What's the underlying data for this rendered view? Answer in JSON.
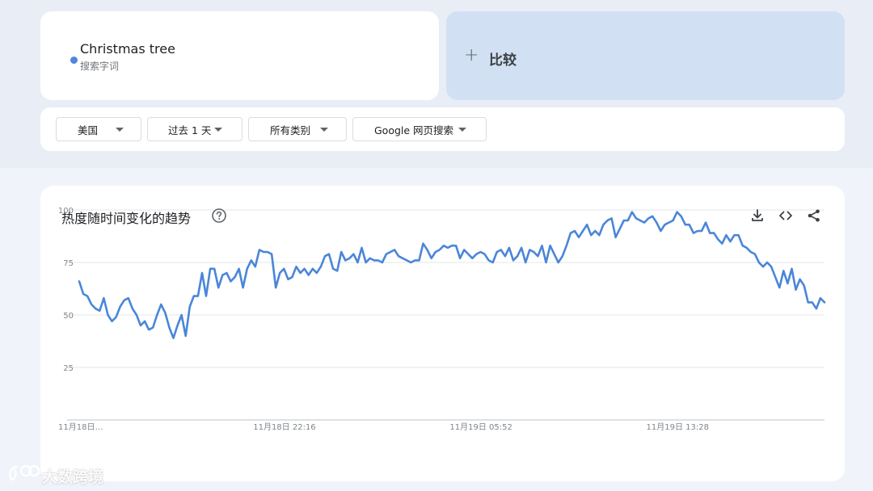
{
  "search_term": {
    "name": "Christmas tree",
    "type": "搜索字词",
    "color": "#4f86e0"
  },
  "compare": {
    "icon": "plus-icon",
    "label": "比较"
  },
  "filters": [
    {
      "label": "美国"
    },
    {
      "label": "过去 1 天"
    },
    {
      "label": "所有类别"
    },
    {
      "label": "Google 网页搜索"
    }
  ],
  "chart_section": {
    "title": "热度随时间变化的趋势",
    "help_icon": "help-circle-icon",
    "actions": [
      "download-icon",
      "embed-code-icon",
      "share-icon"
    ]
  },
  "chart_data": {
    "type": "line",
    "title": "",
    "xlabel": "",
    "ylabel": "",
    "ylim": [
      0,
      100
    ],
    "yticks": [
      25,
      50,
      75,
      100
    ],
    "xtick_labels": [
      "11月18日…",
      "11月18日 22:16",
      "11月19日 05:52",
      "11月19日 13:28"
    ],
    "grid": true,
    "series": [
      {
        "color": "#4a86d8",
        "values": [
          66,
          60,
          59,
          55,
          53,
          52,
          58,
          50,
          47,
          49,
          54,
          57,
          58,
          53,
          50,
          45,
          47,
          43,
          44,
          50,
          55,
          51,
          44,
          39,
          45,
          50,
          40,
          54,
          59,
          59,
          70,
          59,
          72,
          72,
          63,
          69,
          70,
          66,
          68,
          72,
          63,
          72,
          76,
          73,
          81,
          80,
          80,
          79,
          63,
          70,
          72,
          67,
          68,
          73,
          70,
          72,
          69,
          72,
          70,
          73,
          78,
          79,
          72,
          71,
          80,
          76,
          77,
          79,
          75,
          82,
          75,
          77,
          76,
          76,
          75,
          79,
          80,
          81,
          78,
          77,
          76,
          75,
          76,
          76,
          84,
          81,
          77,
          80,
          81,
          83,
          82,
          83,
          83,
          77,
          81,
          79,
          77,
          79,
          80,
          79,
          76,
          75,
          80,
          81,
          78,
          82,
          76,
          78,
          82,
          75,
          81,
          80,
          78,
          83,
          75,
          83,
          79,
          75,
          78,
          83,
          89,
          90,
          87,
          90,
          93,
          88,
          90,
          88,
          93,
          95,
          96,
          87,
          91,
          95,
          95,
          99,
          96,
          95,
          94,
          96,
          97,
          94,
          90,
          93,
          94,
          95,
          99,
          97,
          93,
          93,
          89,
          90,
          90,
          94,
          89,
          89,
          86,
          84,
          88,
          85,
          88,
          88,
          83,
          82,
          80,
          79,
          75,
          73,
          75,
          73,
          68,
          63,
          71,
          65,
          72,
          62,
          67,
          64,
          56,
          56,
          53,
          58,
          56
        ],
        "x_tick_indices": [
          0,
          49,
          97,
          145
        ]
      }
    ]
  },
  "watermark": {
    "text": "大数跨境",
    "logo_icon": "brand-logo-icon"
  }
}
